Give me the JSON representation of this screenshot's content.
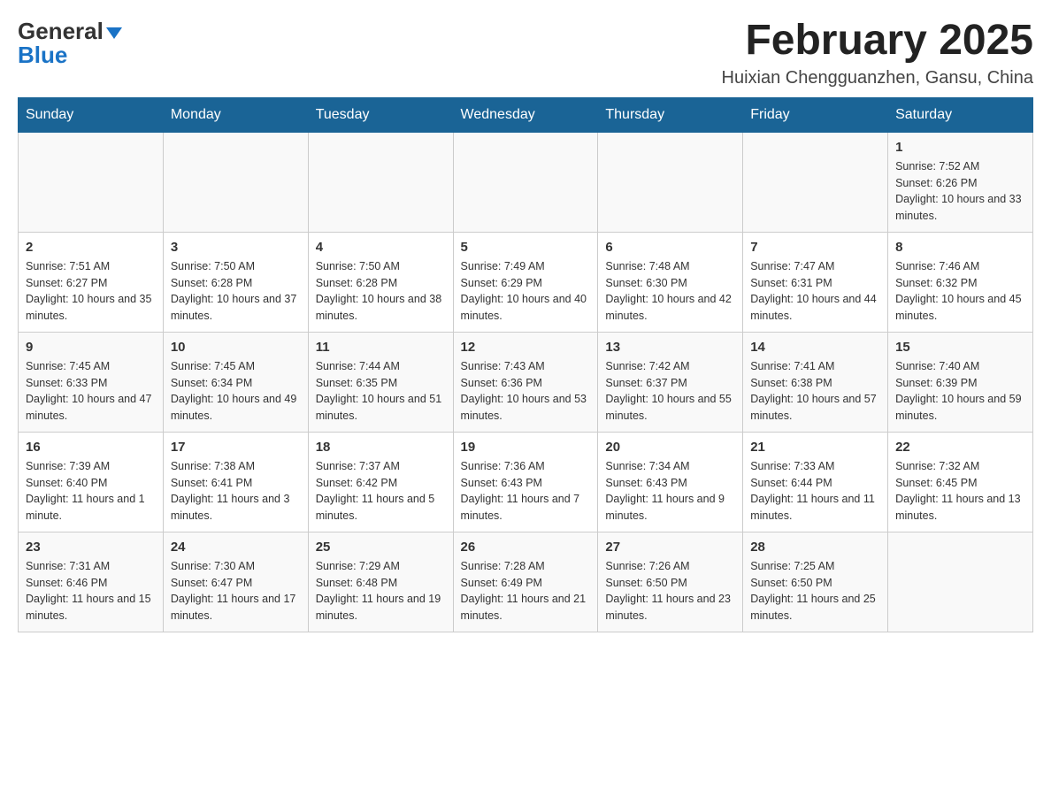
{
  "logo": {
    "text_general": "General",
    "text_blue": "Blue"
  },
  "header": {
    "month_title": "February 2025",
    "location": "Huixian Chengguanzhen, Gansu, China"
  },
  "days_of_week": [
    "Sunday",
    "Monday",
    "Tuesday",
    "Wednesday",
    "Thursday",
    "Friday",
    "Saturday"
  ],
  "weeks": [
    {
      "days": [
        {
          "num": "",
          "info": ""
        },
        {
          "num": "",
          "info": ""
        },
        {
          "num": "",
          "info": ""
        },
        {
          "num": "",
          "info": ""
        },
        {
          "num": "",
          "info": ""
        },
        {
          "num": "",
          "info": ""
        },
        {
          "num": "1",
          "info": "Sunrise: 7:52 AM\nSunset: 6:26 PM\nDaylight: 10 hours and 33 minutes."
        }
      ]
    },
    {
      "days": [
        {
          "num": "2",
          "info": "Sunrise: 7:51 AM\nSunset: 6:27 PM\nDaylight: 10 hours and 35 minutes."
        },
        {
          "num": "3",
          "info": "Sunrise: 7:50 AM\nSunset: 6:28 PM\nDaylight: 10 hours and 37 minutes."
        },
        {
          "num": "4",
          "info": "Sunrise: 7:50 AM\nSunset: 6:28 PM\nDaylight: 10 hours and 38 minutes."
        },
        {
          "num": "5",
          "info": "Sunrise: 7:49 AM\nSunset: 6:29 PM\nDaylight: 10 hours and 40 minutes."
        },
        {
          "num": "6",
          "info": "Sunrise: 7:48 AM\nSunset: 6:30 PM\nDaylight: 10 hours and 42 minutes."
        },
        {
          "num": "7",
          "info": "Sunrise: 7:47 AM\nSunset: 6:31 PM\nDaylight: 10 hours and 44 minutes."
        },
        {
          "num": "8",
          "info": "Sunrise: 7:46 AM\nSunset: 6:32 PM\nDaylight: 10 hours and 45 minutes."
        }
      ]
    },
    {
      "days": [
        {
          "num": "9",
          "info": "Sunrise: 7:45 AM\nSunset: 6:33 PM\nDaylight: 10 hours and 47 minutes."
        },
        {
          "num": "10",
          "info": "Sunrise: 7:45 AM\nSunset: 6:34 PM\nDaylight: 10 hours and 49 minutes."
        },
        {
          "num": "11",
          "info": "Sunrise: 7:44 AM\nSunset: 6:35 PM\nDaylight: 10 hours and 51 minutes."
        },
        {
          "num": "12",
          "info": "Sunrise: 7:43 AM\nSunset: 6:36 PM\nDaylight: 10 hours and 53 minutes."
        },
        {
          "num": "13",
          "info": "Sunrise: 7:42 AM\nSunset: 6:37 PM\nDaylight: 10 hours and 55 minutes."
        },
        {
          "num": "14",
          "info": "Sunrise: 7:41 AM\nSunset: 6:38 PM\nDaylight: 10 hours and 57 minutes."
        },
        {
          "num": "15",
          "info": "Sunrise: 7:40 AM\nSunset: 6:39 PM\nDaylight: 10 hours and 59 minutes."
        }
      ]
    },
    {
      "days": [
        {
          "num": "16",
          "info": "Sunrise: 7:39 AM\nSunset: 6:40 PM\nDaylight: 11 hours and 1 minute."
        },
        {
          "num": "17",
          "info": "Sunrise: 7:38 AM\nSunset: 6:41 PM\nDaylight: 11 hours and 3 minutes."
        },
        {
          "num": "18",
          "info": "Sunrise: 7:37 AM\nSunset: 6:42 PM\nDaylight: 11 hours and 5 minutes."
        },
        {
          "num": "19",
          "info": "Sunrise: 7:36 AM\nSunset: 6:43 PM\nDaylight: 11 hours and 7 minutes."
        },
        {
          "num": "20",
          "info": "Sunrise: 7:34 AM\nSunset: 6:43 PM\nDaylight: 11 hours and 9 minutes."
        },
        {
          "num": "21",
          "info": "Sunrise: 7:33 AM\nSunset: 6:44 PM\nDaylight: 11 hours and 11 minutes."
        },
        {
          "num": "22",
          "info": "Sunrise: 7:32 AM\nSunset: 6:45 PM\nDaylight: 11 hours and 13 minutes."
        }
      ]
    },
    {
      "days": [
        {
          "num": "23",
          "info": "Sunrise: 7:31 AM\nSunset: 6:46 PM\nDaylight: 11 hours and 15 minutes."
        },
        {
          "num": "24",
          "info": "Sunrise: 7:30 AM\nSunset: 6:47 PM\nDaylight: 11 hours and 17 minutes."
        },
        {
          "num": "25",
          "info": "Sunrise: 7:29 AM\nSunset: 6:48 PM\nDaylight: 11 hours and 19 minutes."
        },
        {
          "num": "26",
          "info": "Sunrise: 7:28 AM\nSunset: 6:49 PM\nDaylight: 11 hours and 21 minutes."
        },
        {
          "num": "27",
          "info": "Sunrise: 7:26 AM\nSunset: 6:50 PM\nDaylight: 11 hours and 23 minutes."
        },
        {
          "num": "28",
          "info": "Sunrise: 7:25 AM\nSunset: 6:50 PM\nDaylight: 11 hours and 25 minutes."
        },
        {
          "num": "",
          "info": ""
        }
      ]
    }
  ]
}
